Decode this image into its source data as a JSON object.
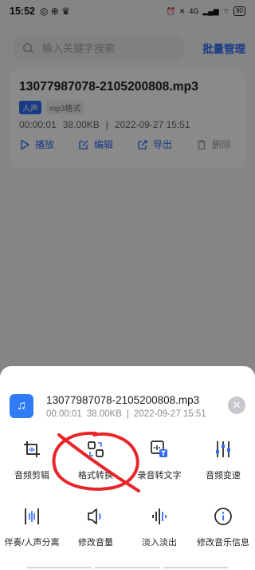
{
  "status": {
    "time": "15:52",
    "right": "4G",
    "battery": "90"
  },
  "search": {
    "placeholder": "输入关键字搜索",
    "batch_label": "批量管理"
  },
  "file": {
    "name": "13077987078-2105200808.mp3",
    "tags": [
      "人声",
      "mp3格式"
    ],
    "duration": "00:00:01",
    "size": "38.00KB",
    "date": "2022-09-27 15:51",
    "actions": [
      {
        "label": "播放",
        "icon": "play-icon"
      },
      {
        "label": "编辑",
        "icon": "edit-icon"
      },
      {
        "label": "导出",
        "icon": "export-icon"
      },
      {
        "label": "删除",
        "icon": "trash-icon"
      }
    ]
  },
  "sheet": {
    "title": "13077987078-2105200808.mp3",
    "duration": "00:00:01",
    "size": "38.00KB",
    "separator": "|",
    "date": "2022-09-27 15:51",
    "close": "✕",
    "tools": [
      {
        "label": "音频剪辑",
        "icon": "crop-icon"
      },
      {
        "label": "格式转换",
        "icon": "convert-icon"
      },
      {
        "label": "录音转文字",
        "icon": "speech-to-text-icon"
      },
      {
        "label": "音频变速",
        "icon": "speed-sliders-icon"
      },
      {
        "label": "伴奏/人声分离",
        "icon": "split-icon"
      },
      {
        "label": "修改音量",
        "icon": "volume-icon"
      },
      {
        "label": "淡入淡出",
        "icon": "waveform-icon"
      },
      {
        "label": "修改音乐信息",
        "icon": "info-icon"
      }
    ]
  },
  "colors": {
    "accent": "#2f6cf6",
    "annotation": "#e8262a"
  }
}
